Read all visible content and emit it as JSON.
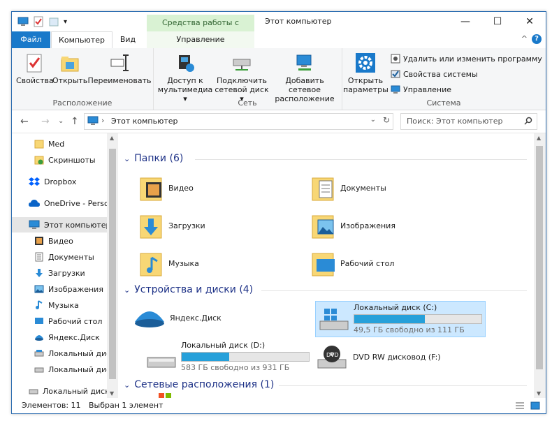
{
  "window": {
    "title": "Этот компьютер",
    "tools_tab": "Средства работы с дисками",
    "minimize": "—",
    "maximize": "☐",
    "close": "✕"
  },
  "tabs": {
    "file": "Файл",
    "computer": "Компьютер",
    "view": "Вид",
    "manage": "Управление"
  },
  "ribbon": {
    "location": {
      "label": "Расположение",
      "properties": "Свойства",
      "open": "Открыть",
      "rename": "Переименовать"
    },
    "network": {
      "label": "Сеть",
      "media_1": "Доступ к",
      "media_2": "мультимедиа ▾",
      "map_1": "Подключить",
      "map_2": "сетевой диск ▾",
      "add_1": "Добавить сетевое",
      "add_2": "расположение"
    },
    "system": {
      "label": "Система",
      "open_1": "Открыть",
      "open_2": "параметры",
      "uninstall": "Удалить или изменить программу",
      "sysprops": "Свойства системы",
      "manage": "Управление"
    }
  },
  "nav": {
    "address": "Этот компьютер",
    "search_placeholder": "Поиск: Этот компьютер"
  },
  "sidebar": [
    {
      "label": "Med",
      "icon": "folder-icon"
    },
    {
      "label": "Скриншоты",
      "icon": "folder-check-icon"
    },
    {
      "label": "Dropbox",
      "icon": "dropbox-icon"
    },
    {
      "label": "OneDrive - Persor",
      "icon": "onedrive-icon"
    },
    {
      "label": "Этот компьютер",
      "icon": "computer-icon",
      "selected": true
    },
    {
      "label": "Видео",
      "icon": "video-icon"
    },
    {
      "label": "Документы",
      "icon": "documents-icon"
    },
    {
      "label": "Загрузки",
      "icon": "downloads-icon"
    },
    {
      "label": "Изображения",
      "icon": "pictures-icon"
    },
    {
      "label": "Музыка",
      "icon": "music-icon"
    },
    {
      "label": "Рабочий стол",
      "icon": "desktop-icon"
    },
    {
      "label": "Яндекс.Диск",
      "icon": "yandex-disk-icon"
    },
    {
      "label": "Локальный дис",
      "icon": "drive-icon"
    },
    {
      "label": "Локальный дис",
      "icon": "drive-icon"
    },
    {
      "label": "Локальный диск",
      "icon": "drive-icon"
    }
  ],
  "content": {
    "folders_header": "Папки (6)",
    "folders": [
      {
        "label": "Видео"
      },
      {
        "label": "Документы"
      },
      {
        "label": "Загрузки"
      },
      {
        "label": "Изображения"
      },
      {
        "label": "Музыка"
      },
      {
        "label": "Рабочий стол"
      }
    ],
    "devices_header": "Устройства и диски (4)",
    "yandex": "Яндекс.Диск",
    "drive_c": {
      "name": "Локальный диск (C:)",
      "free": "49,5 ГБ свободно из 111 ГБ",
      "used_fraction": 0.554
    },
    "drive_d": {
      "name": "Локальный диск (D:)",
      "free": "583 ГБ свободно из 931 ГБ",
      "used_fraction": 0.374
    },
    "dvd": "DVD RW дисковод (F:)",
    "network_header": "Сетевые расположения (1)"
  },
  "status": {
    "items": "Элементов: 11",
    "selected": "Выбран 1 элемент"
  },
  "colors": {
    "accent": "#1979ca",
    "bar": "#26a0da",
    "selected": "#cce8ff"
  }
}
